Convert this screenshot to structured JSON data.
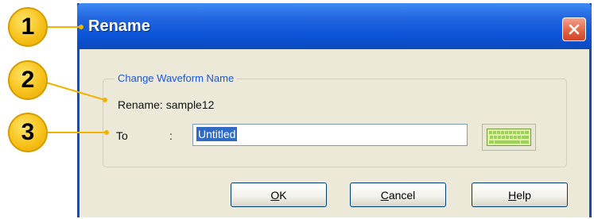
{
  "callouts": [
    "1",
    "2",
    "3"
  ],
  "dialog": {
    "title": "Rename",
    "group_title": "Change Waveform Name",
    "rename_prefix": "Rename:",
    "rename_value": "sample12",
    "to_label": "To",
    "colon": ":",
    "to_value": "Untitled"
  },
  "buttons": {
    "ok": {
      "mnemonic": "O",
      "rest": "K"
    },
    "cancel": {
      "mnemonic": "C",
      "rest": "ancel"
    },
    "help": {
      "mnemonic": "H",
      "rest": "elp"
    }
  },
  "icons": {
    "close": "close-icon",
    "keyboard": "keyboard-icon"
  },
  "colors": {
    "titlebar": "#0c55d8",
    "callout": "#f7c21b",
    "group_title": "#1c55d6",
    "selection": "#316ac5"
  }
}
